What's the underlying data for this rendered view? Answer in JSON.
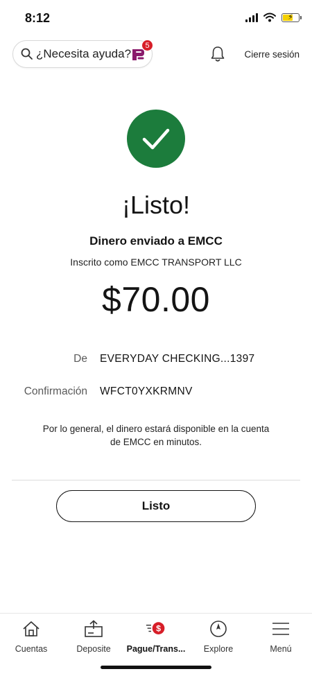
{
  "status_bar": {
    "time": "8:12"
  },
  "header": {
    "help_placeholder": "¿Necesita ayuda?",
    "assistant_badge": "5",
    "signout_label": "Cierre sesión"
  },
  "confirmation": {
    "heading": "¡Listo!",
    "recipient_line": "Dinero enviado a EMCC",
    "enrolled_line": "Inscrito como EMCC TRANSPORT LLC",
    "amount": "$70.00",
    "details": [
      {
        "label": "De",
        "value": "EVERYDAY CHECKING...1397"
      },
      {
        "label": "Confirmación",
        "value": "WFCT0YXKRMNV"
      }
    ],
    "note": "Por lo general, el dinero estará disponible en la cuenta de EMCC en minutos.",
    "done_label": "Listo"
  },
  "bottom_nav": [
    {
      "label": "Cuentas",
      "icon": "home-icon"
    },
    {
      "label": "Deposite",
      "icon": "deposit-icon"
    },
    {
      "label": "Pague/Trans...",
      "icon": "pay-transfer-icon",
      "active": true
    },
    {
      "label": "Explore",
      "icon": "compass-icon"
    },
    {
      "label": "Menú",
      "icon": "menu-icon"
    }
  ],
  "colors": {
    "success_green": "#1c7c3c",
    "brand_red": "#d71e28",
    "assistant_purple": "#8a1a6b",
    "battery_yellow": "#f4d000"
  }
}
